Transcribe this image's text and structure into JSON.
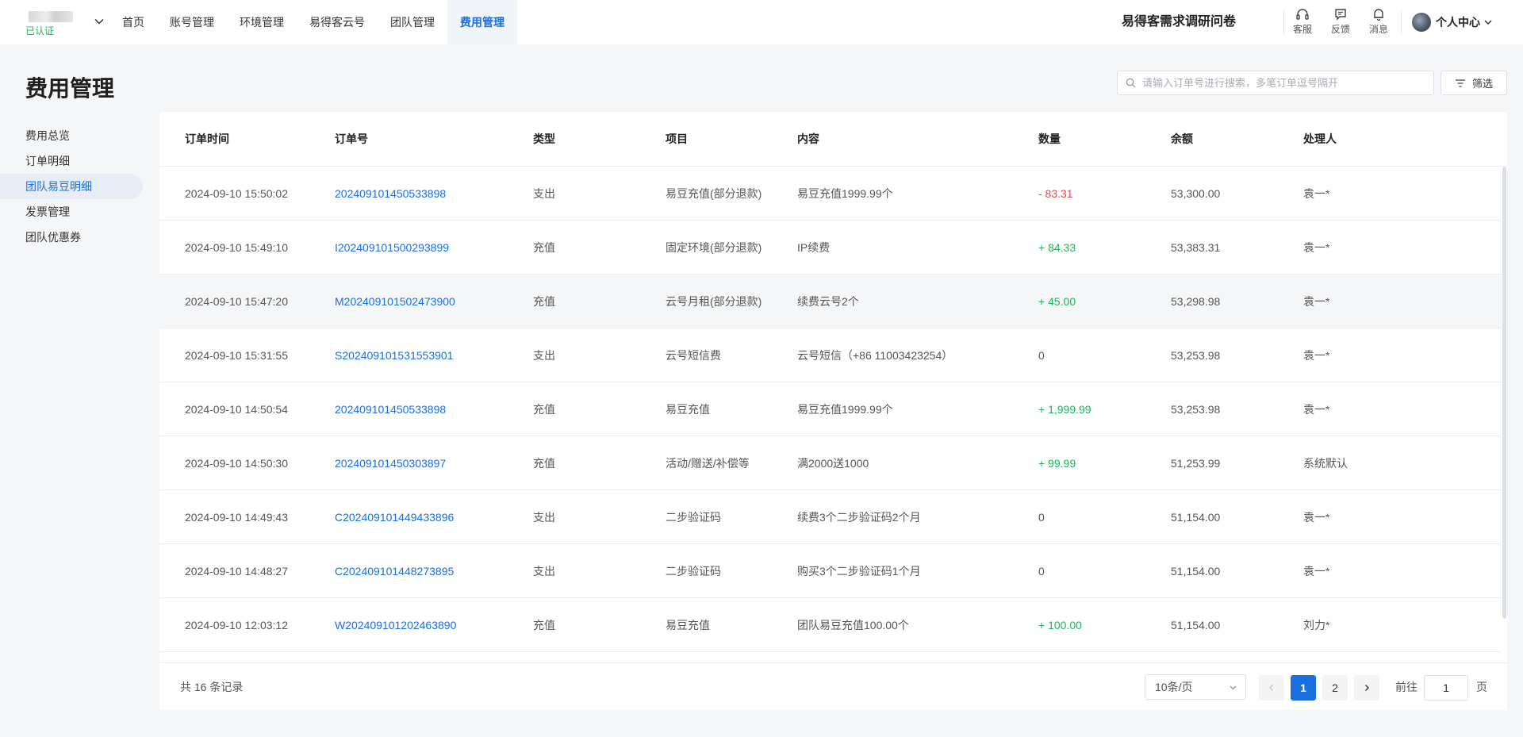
{
  "header": {
    "verified_label": "已认证",
    "nav": [
      {
        "label": "首页",
        "active": false
      },
      {
        "label": "账号管理",
        "active": false
      },
      {
        "label": "环境管理",
        "active": false
      },
      {
        "label": "易得客云号",
        "active": false
      },
      {
        "label": "团队管理",
        "active": false
      },
      {
        "label": "费用管理",
        "active": true
      }
    ],
    "survey_label": "易得客需求调研问卷",
    "tools": [
      {
        "icon": "headset-icon",
        "label": "客服"
      },
      {
        "icon": "feedback-icon",
        "label": "反馈"
      },
      {
        "icon": "bell-icon",
        "label": "消息"
      }
    ],
    "user_label": "个人中心"
  },
  "page": {
    "title": "费用管理"
  },
  "sidebar": {
    "items": [
      {
        "label": "费用总览",
        "active": false
      },
      {
        "label": "订单明细",
        "active": false
      },
      {
        "label": "团队易豆明细",
        "active": true
      },
      {
        "label": "发票管理",
        "active": false
      },
      {
        "label": "团队优惠券",
        "active": false
      }
    ]
  },
  "toolbar": {
    "search_placeholder": "请输入订单号进行搜索，多笔订单逗号隔开",
    "filter_label": "筛选"
  },
  "table": {
    "columns": [
      "订单时间",
      "订单号",
      "类型",
      "项目",
      "内容",
      "数量",
      "余额",
      "处理人"
    ],
    "rows": [
      {
        "time": "2024-09-10 15:50:02",
        "order": "202409101450533898",
        "type": "支出",
        "item": "易豆充值(部分退款)",
        "content": "易豆充值1999.99个",
        "qty": "- 83.31",
        "qty_sign": "neg",
        "balance": "53,300.00",
        "handler": "袁一*"
      },
      {
        "time": "2024-09-10 15:49:10",
        "order": "I202409101500293899",
        "type": "充值",
        "item": "固定环境(部分退款)",
        "content": "IP续费",
        "qty": "+ 84.33",
        "qty_sign": "pos",
        "balance": "53,383.31",
        "handler": "袁一*"
      },
      {
        "time": "2024-09-10 15:47:20",
        "order": "M202409101502473900",
        "type": "充值",
        "item": "云号月租(部分退款)",
        "content": "续费云号2个",
        "qty": "+ 45.00",
        "qty_sign": "pos",
        "balance": "53,298.98",
        "handler": "袁一*"
      },
      {
        "time": "2024-09-10 15:31:55",
        "order": "S202409101531553901",
        "type": "支出",
        "item": "云号短信费",
        "content": "云号短信（+86 11003423254）",
        "qty": "0",
        "qty_sign": "zero",
        "balance": "53,253.98",
        "handler": "袁一*"
      },
      {
        "time": "2024-09-10 14:50:54",
        "order": "202409101450533898",
        "type": "充值",
        "item": "易豆充值",
        "content": "易豆充值1999.99个",
        "qty": "+ 1,999.99",
        "qty_sign": "pos",
        "balance": "53,253.98",
        "handler": "袁一*"
      },
      {
        "time": "2024-09-10 14:50:30",
        "order": "202409101450303897",
        "type": "充值",
        "item": "活动/赠送/补偿等",
        "content": "满2000送1000",
        "qty": "+ 99.99",
        "qty_sign": "pos",
        "balance": "51,253.99",
        "handler": "系统默认"
      },
      {
        "time": "2024-09-10 14:49:43",
        "order": "C202409101449433896",
        "type": "支出",
        "item": "二步验证码",
        "content": "续费3个二步验证码2个月",
        "qty": "0",
        "qty_sign": "zero",
        "balance": "51,154.00",
        "handler": "袁一*"
      },
      {
        "time": "2024-09-10 14:48:27",
        "order": "C202409101448273895",
        "type": "支出",
        "item": "二步验证码",
        "content": "购买3个二步验证码1个月",
        "qty": "0",
        "qty_sign": "zero",
        "balance": "51,154.00",
        "handler": "袁一*"
      },
      {
        "time": "2024-09-10 12:03:12",
        "order": "W202409101202463890",
        "type": "充值",
        "item": "易豆充值",
        "content": "团队易豆充值100.00个",
        "qty": "+ 100.00",
        "qty_sign": "pos",
        "balance": "51,154.00",
        "handler": "刘力*"
      }
    ]
  },
  "pagination": {
    "total_label": "共 16 条记录",
    "page_size": "10条/页",
    "pages": [
      "1",
      "2"
    ],
    "current_page": "1",
    "goto_prefix": "前往",
    "goto_value": "1",
    "goto_suffix": "页"
  }
}
